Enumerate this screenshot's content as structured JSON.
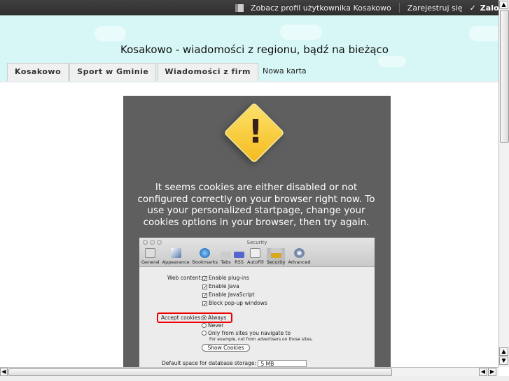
{
  "topbar": {
    "profile_link": "Zobacz profil użytkownika Kosakowo",
    "register_link": "Zarejestruj się",
    "login_link": "Zaloguj"
  },
  "header": {
    "title": "Kosakowo - wiadomości z regionu, bądź na bieżąco"
  },
  "tabs": [
    {
      "label": "Kosakowo"
    },
    {
      "label": "Sport w Gminie"
    },
    {
      "label": "Wiadomości z firm"
    },
    {
      "label": "Nowa karta"
    }
  ],
  "warning": {
    "icon": "warning-icon",
    "color": "#f5bb1f",
    "message": "It seems cookies are either disabled or not configured correctly on your browser right now. To use your personalized startpage, change your cookies options in your browser, then try again."
  },
  "screenshot": {
    "window_title": "Security",
    "toolbar": [
      "General",
      "Appearance",
      "Bookmarks",
      "Tabs",
      "RSS",
      "AutoFill",
      "Security",
      "Advanced"
    ],
    "web_content_label": "Web content:",
    "checkboxes": [
      "Enable plug-ins",
      "Enable Java",
      "Enable JavaScript",
      "Block pop-up windows"
    ],
    "cookies_label": "Accept cookies:",
    "cookie_options": [
      "Always",
      "Never",
      "Only from sites you navigate to"
    ],
    "cookie_hint": "For example, not from advertisers on those sites.",
    "show_cookies": "Show Cookies",
    "db_label": "Default space for database storage:",
    "db_value": "5 MB"
  }
}
